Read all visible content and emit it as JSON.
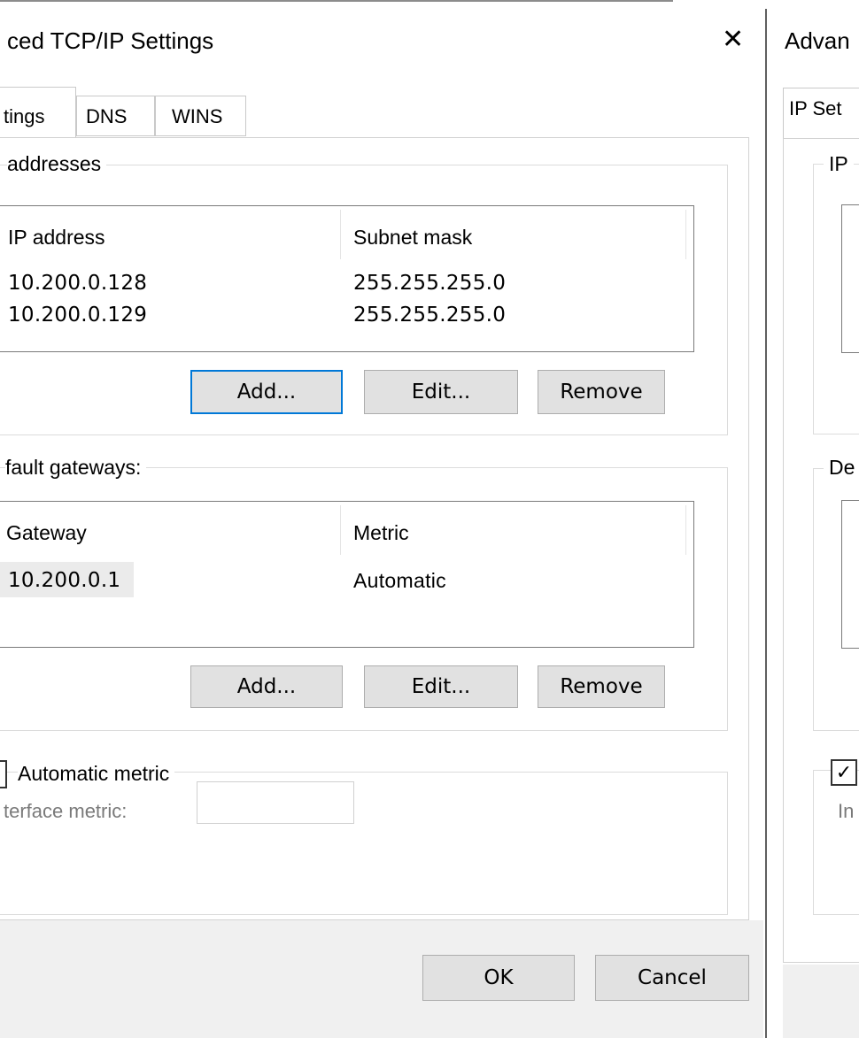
{
  "dialog_left": {
    "title": "ced TCP/IP Settings",
    "tabs": [
      {
        "label": "tings"
      },
      {
        "label": "DNS"
      },
      {
        "label": "WINS"
      }
    ],
    "ip_addresses_group": {
      "legend": "addresses",
      "columns": [
        "IP address",
        "Subnet mask"
      ],
      "rows": [
        {
          "ip": "10.200.0.128",
          "mask": "255.255.255.0"
        },
        {
          "ip": "10.200.0.129",
          "mask": "255.255.255.0"
        }
      ],
      "buttons": {
        "add": "Add...",
        "edit": "Edit...",
        "remove": "Remove"
      }
    },
    "gateways_group": {
      "legend": "fault gateways:",
      "columns": [
        "Gateway",
        "Metric"
      ],
      "rows": [
        {
          "gateway": "10.200.0.1",
          "metric": "Automatic"
        }
      ],
      "buttons": {
        "add": "Add...",
        "edit": "Edit...",
        "remove": "Remove"
      }
    },
    "metric_group": {
      "legend": "Automatic metric",
      "interface_metric_label": "terface metric:",
      "interface_metric_value": ""
    },
    "footer": {
      "ok": "OK",
      "cancel": "Cancel"
    }
  },
  "dialog_right": {
    "title": "Advan",
    "tab_label": "IP Set",
    "group1_legend": "IP",
    "group2_legend": "De",
    "interface_label": "In"
  }
}
